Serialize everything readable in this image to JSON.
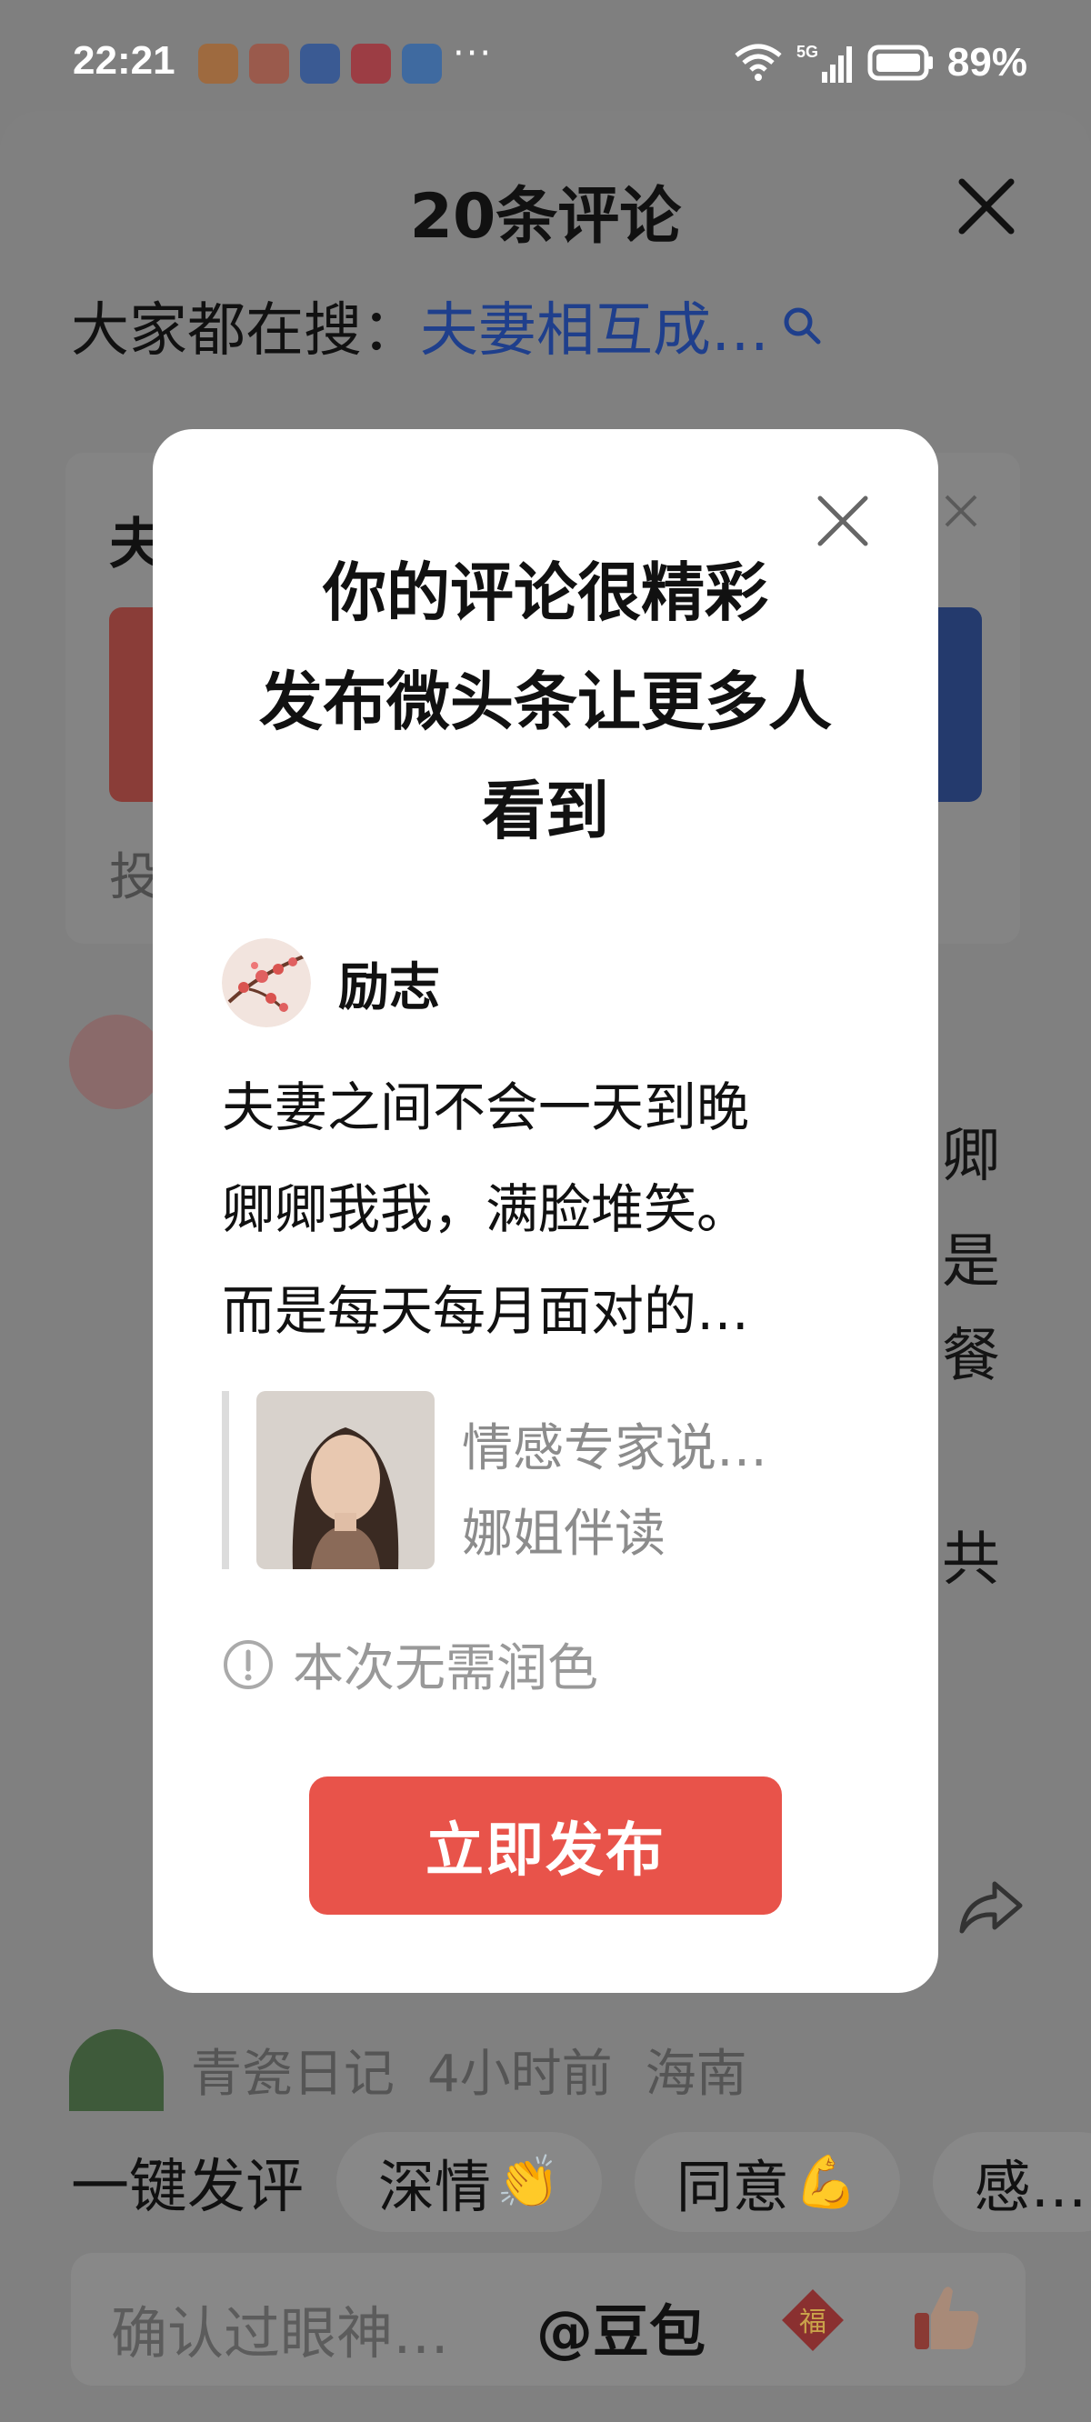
{
  "status_bar": {
    "time": "22:21",
    "battery": "89%",
    "network": "5G",
    "more": "···",
    "app_icons": [
      "health-app",
      "cartoon-app",
      "app-market",
      "video-app",
      "notes-app"
    ]
  },
  "sheet": {
    "title": "20条评论",
    "search_label": "大家都在搜：",
    "search_query": "夫妻相互成…",
    "bg_card_initial": "夫",
    "bg_card_sub": "投",
    "bg_comment_chars": [
      "卿",
      "是",
      "餐",
      "共"
    ],
    "bg_comment_meta": {
      "name": "青瓷日记",
      "time": "4小时前",
      "location": "海南"
    }
  },
  "quick_reply": {
    "label": "一键发评",
    "chips": [
      {
        "text": "深情",
        "emoji": "👏"
      },
      {
        "text": "同意",
        "emoji": "💪"
      },
      {
        "text": "感…",
        "emoji": ""
      }
    ]
  },
  "input_bar": {
    "placeholder": "确认过眼神…",
    "mention": "@豆包",
    "fu_char": "福"
  },
  "modal": {
    "title_lines": [
      "你的评论很精彩",
      "发布微头条让更多人",
      "看到"
    ],
    "author_name": "励志",
    "post_lines": [
      "夫妻之间不会一天到晚",
      "卿卿我我，满脸堆笑。",
      "而是每天每月面对的…"
    ],
    "quote_title": "情感专家说…",
    "quote_author": "娜姐伴读",
    "notice": "本次无需润色",
    "publish_label": "立即发布"
  },
  "colors": {
    "overlay": "#7f7f7f",
    "link_blue": "#1f3f8c",
    "primary_red": "#e8534a",
    "muted_text": "#8c8c8c"
  }
}
